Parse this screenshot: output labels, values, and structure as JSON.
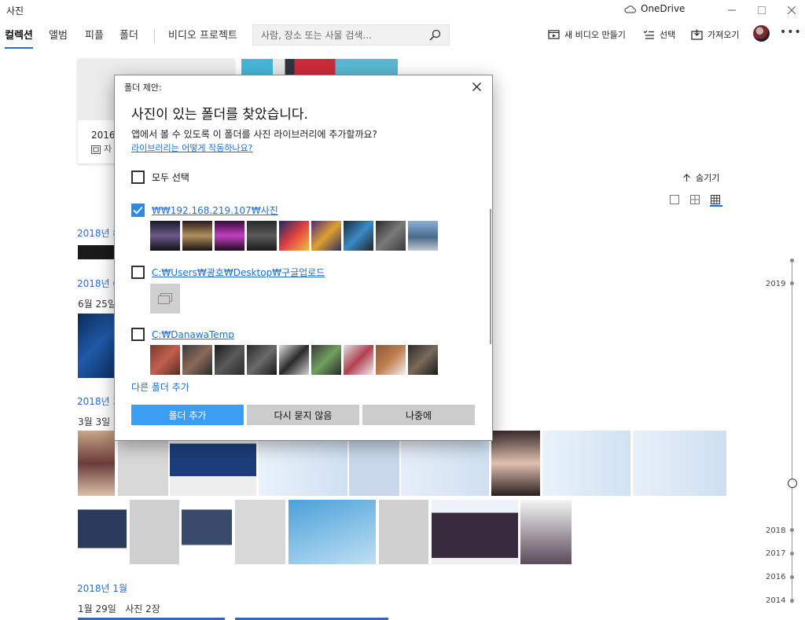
{
  "app": {
    "title": "사진",
    "onedrive_label": "OneDrive"
  },
  "nav": {
    "tabs": [
      {
        "label": "컬렉션",
        "active": true
      },
      {
        "label": "앨범",
        "active": false
      },
      {
        "label": "피플",
        "active": false
      },
      {
        "label": "폴더",
        "active": false
      },
      {
        "label": "비디오 프로젝트",
        "active": false
      }
    ],
    "search_placeholder": "사람, 장소 또는 사물 검색..."
  },
  "commands": {
    "new_video": "새 비디오 만들기",
    "select": "선택",
    "import": "가져오기"
  },
  "collection": {
    "album_year": "2016",
    "album_sub": "자",
    "hide_label": "숨기기",
    "sections": [
      {
        "date": "2018년 8"
      },
      {
        "date": "2018년 6"
      },
      {
        "date": "2018년 3"
      },
      {
        "date": "2018년 1월"
      }
    ],
    "days": [
      {
        "label": "6월 25일"
      },
      {
        "label": "3월 3일"
      },
      {
        "label": "1월 29일   사진 2장"
      }
    ],
    "timeline_years": [
      "2019",
      "2018",
      "2017",
      "2016",
      "2014"
    ]
  },
  "dialog": {
    "title": "폴더 제안:",
    "heading": "사진이 있는 폴더를 찾았습니다.",
    "description": "앱에서 볼 수 있도록 이 폴더를 사진 라이브러리에 추가할까요?",
    "help_link": "라이브러리는 어떻게 작동하나요?",
    "select_all_label": "모두 선택",
    "folders": [
      {
        "path": "₩₩192.168.219.107₩사진",
        "checked": true
      },
      {
        "path": "C:₩Users₩광호₩Desktop₩구글업로드",
        "checked": false
      },
      {
        "path": "C:₩DanawaTemp",
        "checked": false
      }
    ],
    "add_other_folder": "다른 폴더 추가",
    "buttons": {
      "add": "폴더 추가",
      "never": "다시 묻지 않음",
      "later": "나중에"
    }
  },
  "colors": {
    "accent": "#1f6fd1",
    "primary_button": "#3c9ef2",
    "secondary_button": "#cccccc"
  }
}
